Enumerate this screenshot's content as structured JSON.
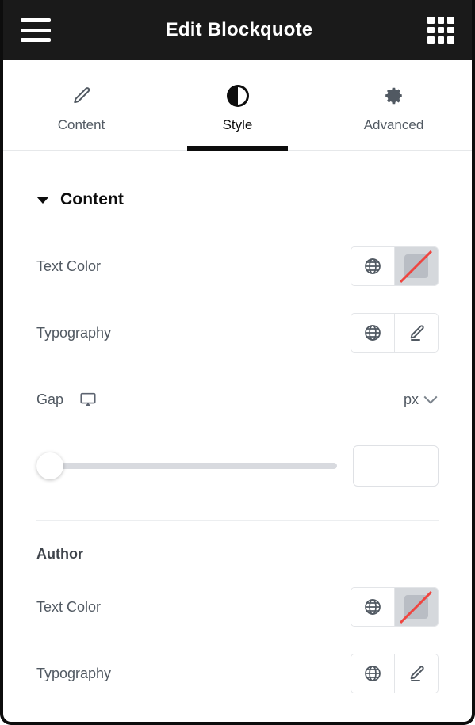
{
  "header": {
    "title": "Edit Blockquote",
    "menu_icon": "hamburger-menu-icon",
    "apps_icon": "apps-grid-icon"
  },
  "tabs": [
    {
      "label": "Content",
      "icon": "pencil-icon",
      "active": false
    },
    {
      "label": "Style",
      "icon": "contrast-icon",
      "active": true
    },
    {
      "label": "Advanced",
      "icon": "gear-icon",
      "active": false
    }
  ],
  "section": {
    "title": "Content",
    "expanded": true
  },
  "controls": {
    "content_text_color": {
      "label": "Text Color",
      "globe_icon": "globe-icon",
      "swatch_state": "none"
    },
    "content_typography": {
      "label": "Typography",
      "globe_icon": "globe-icon",
      "edit_icon": "pencil-edit-icon"
    },
    "gap": {
      "label": "Gap",
      "device_icon": "desktop-icon",
      "unit": "px",
      "unit_chevron": "chevron-down-icon",
      "value": "",
      "placeholder": ""
    },
    "author_heading": "Author",
    "author_text_color": {
      "label": "Text Color",
      "globe_icon": "globe-icon",
      "swatch_state": "none"
    },
    "author_typography": {
      "label": "Typography",
      "globe_icon": "globe-icon",
      "edit_icon": "pencil-edit-icon"
    }
  },
  "colors": {
    "header_bg": "#1a1a1a",
    "panel_border": "#0d0d0d",
    "label_text": "#515962",
    "heading_text": "#0d0d0d",
    "swatch_slash": "#ef4540",
    "swatch_bg": "#b9bdc4",
    "track": "#d8dadf",
    "border": "#e3e5e8"
  }
}
